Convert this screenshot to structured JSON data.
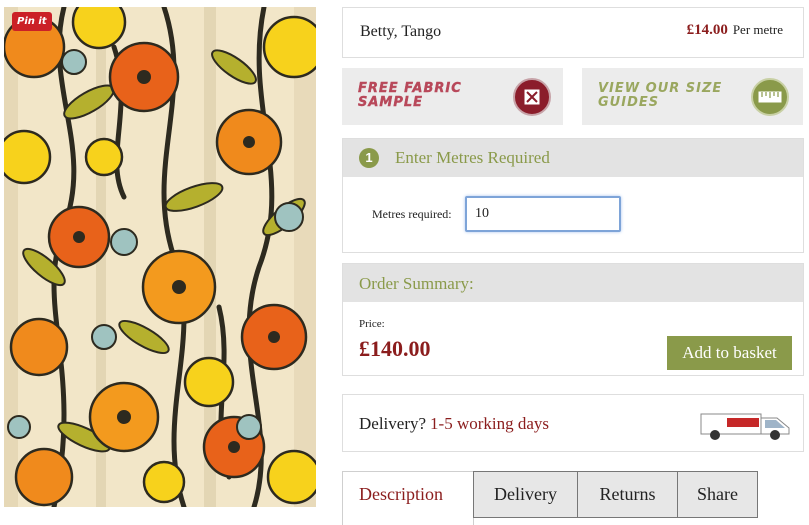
{
  "image": {
    "pin_label": "Pin it"
  },
  "product": {
    "name": "Betty, Tango",
    "price": "£14.00",
    "price_unit": "Per metre"
  },
  "promos": {
    "sample_text": "Free Fabric Sample",
    "guides_text": "View Our Size Guides",
    "sample_icon": "fabric-swatch-icon",
    "guides_icon": "size-guide-icon"
  },
  "step": {
    "number": "1",
    "title": "Enter Metres Required",
    "metres_label": "Metres required:",
    "metres_value": "10"
  },
  "summary": {
    "title": "Order Summary:",
    "price_label": "Price:",
    "total": "£140.00",
    "basket_label": "Add to basket"
  },
  "delivery": {
    "question": "Delivery?",
    "days": "1-5 working days",
    "icon": "delivery-van-icon"
  },
  "tabs": [
    {
      "label": "Description",
      "active": true
    },
    {
      "label": "Delivery",
      "active": false
    },
    {
      "label": "Returns",
      "active": false
    },
    {
      "label": "Share",
      "active": false
    }
  ],
  "colors": {
    "accent_green": "#8a9a4a",
    "price_red": "#8b1d1d",
    "header_grey": "#e3e3e3"
  }
}
